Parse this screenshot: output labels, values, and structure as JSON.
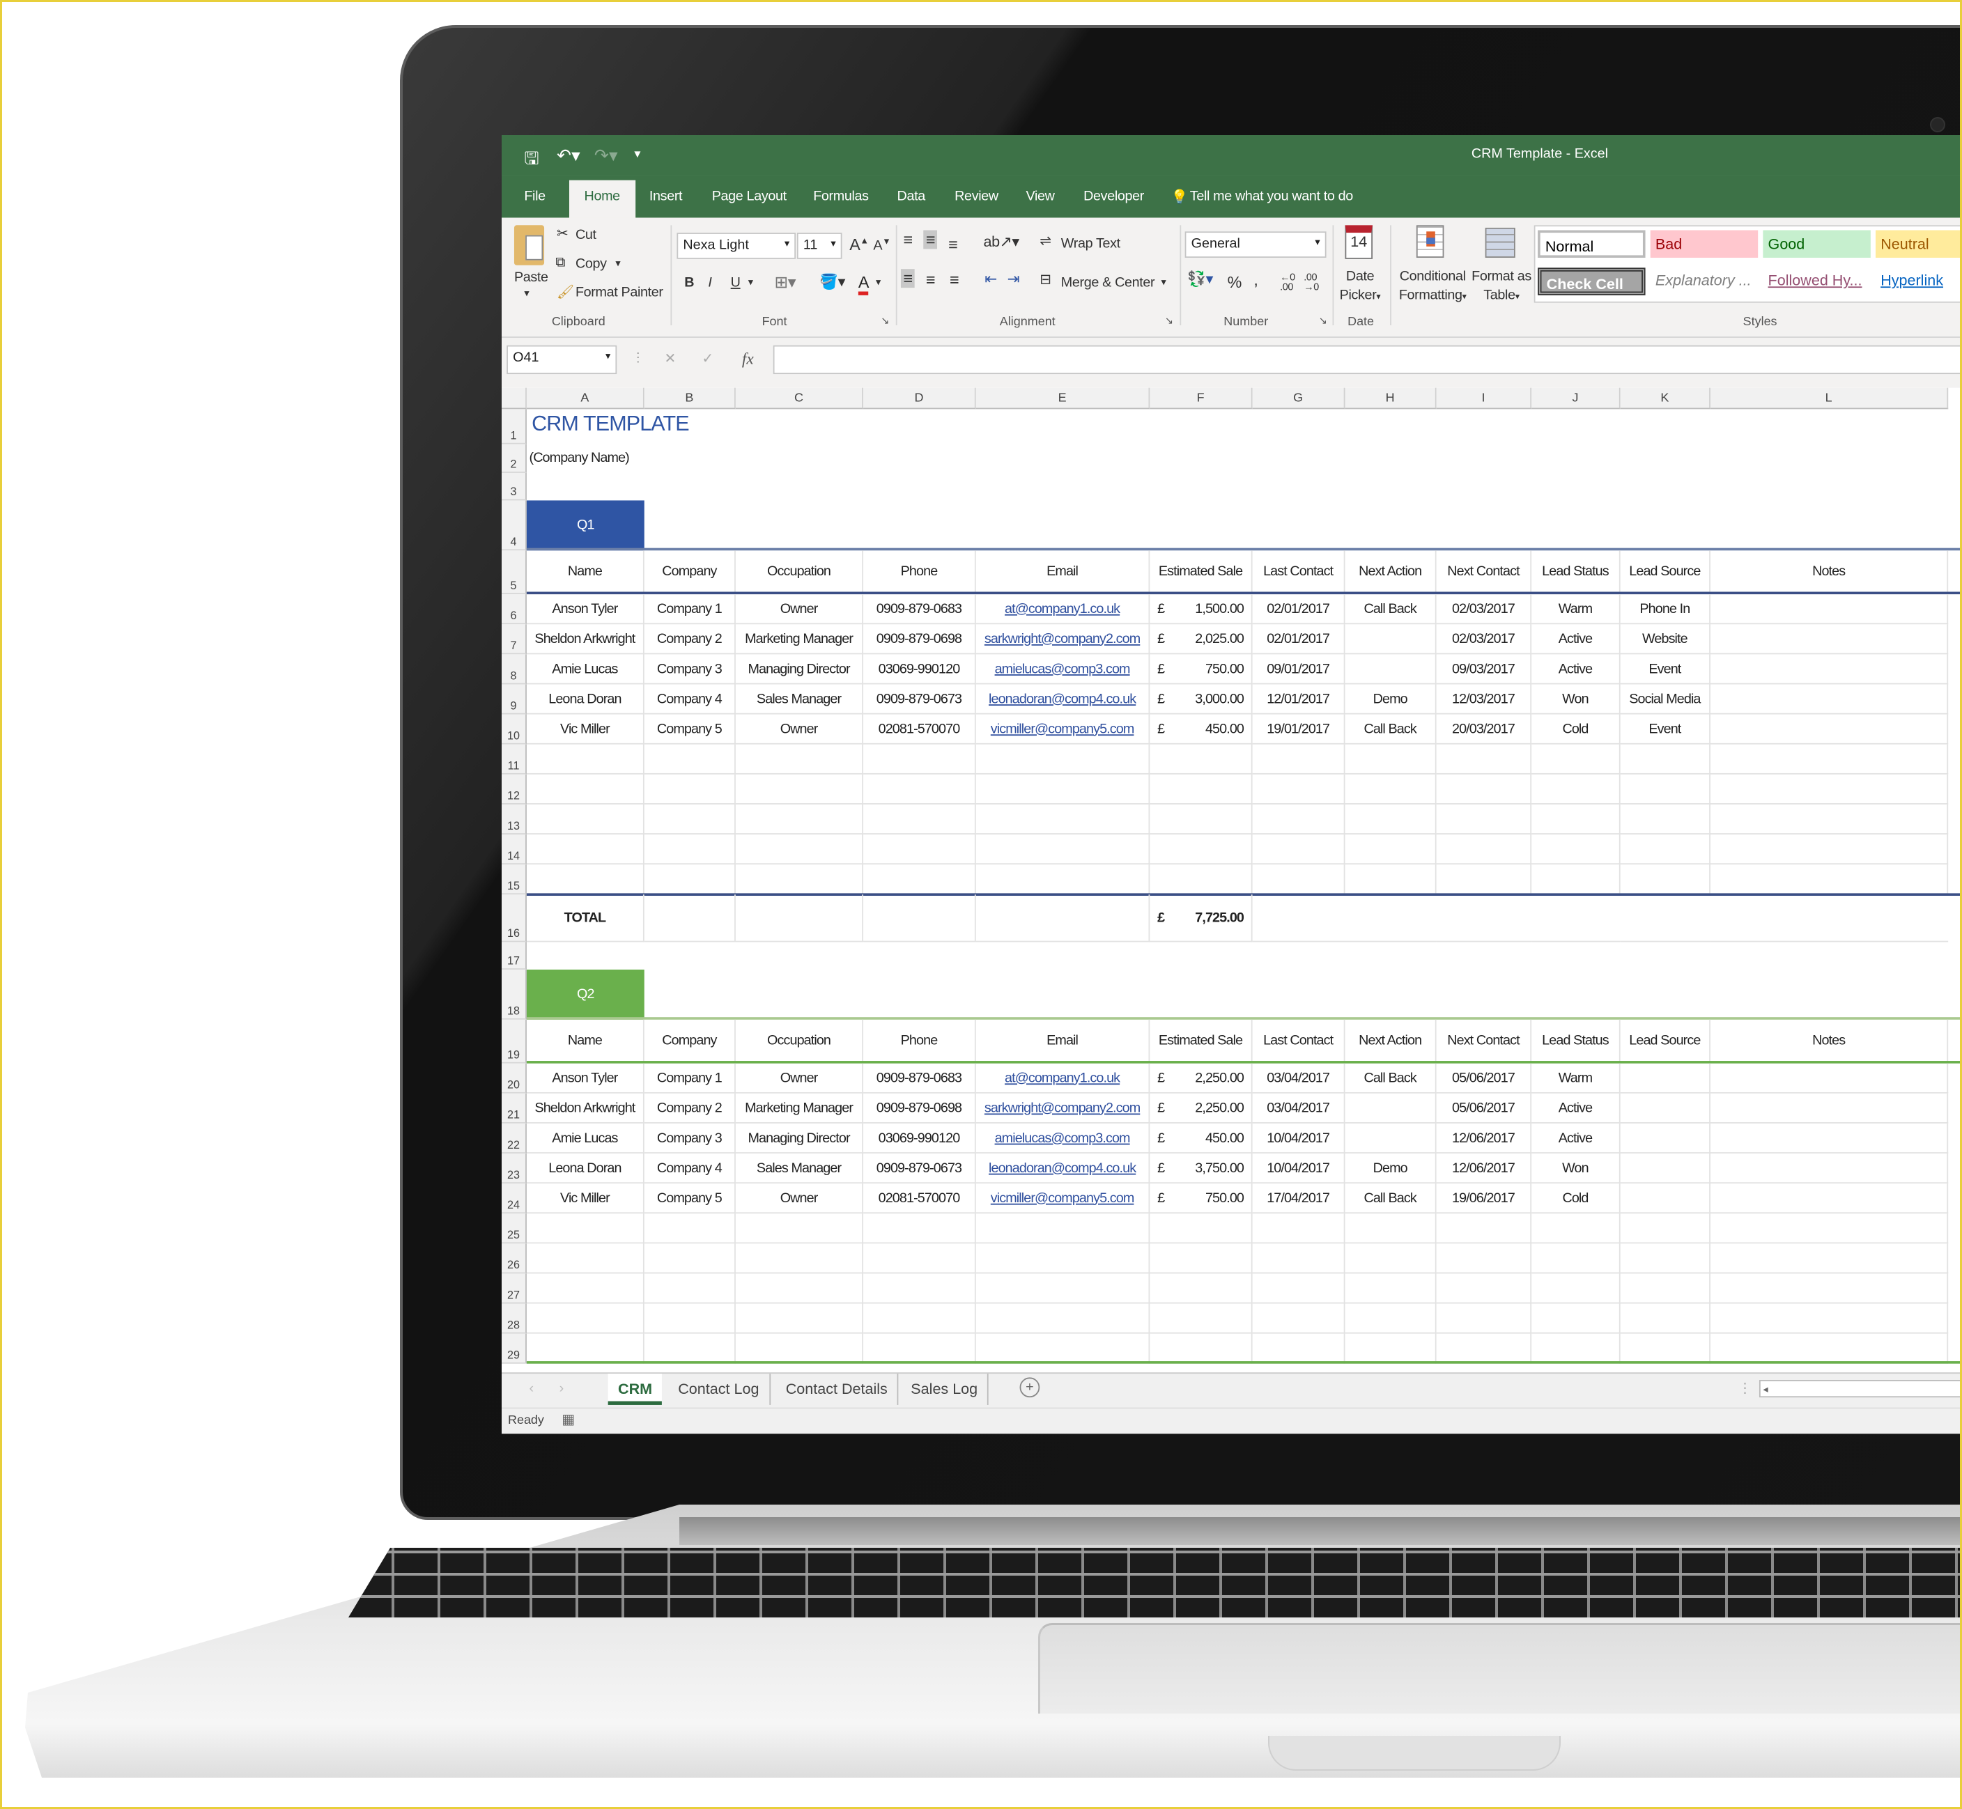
{
  "window": {
    "title": "CRM Template  -  Excel",
    "accent": "#3d7247"
  },
  "quick_access": {
    "save_icon": "save-icon",
    "undo_icon": "undo-icon",
    "redo_icon": "redo-icon",
    "customize_icon": "customize-icon"
  },
  "ribbon_tabs": [
    "File",
    "Home",
    "Insert",
    "Page Layout",
    "Formulas",
    "Data",
    "Review",
    "View",
    "Developer"
  ],
  "active_tab": "Home",
  "tell_me": "Tell me what you want to do",
  "clipboard": {
    "paste": "Paste",
    "cut": "Cut",
    "copy": "Copy",
    "format_painter": "Format Painter",
    "label": "Clipboard"
  },
  "font": {
    "name": "Nexa Light",
    "size": "11",
    "bold": "B",
    "italic": "I",
    "underline": "U",
    "label": "Font"
  },
  "alignment": {
    "wrap_text": "Wrap Text",
    "merge_center": "Merge & Center",
    "label": "Alignment"
  },
  "number": {
    "format": "General",
    "percent": "%",
    "comma": ",",
    "label": "Number"
  },
  "date": {
    "day": "14",
    "button_line1": "Date",
    "button_line2": "Picker",
    "label": "Date"
  },
  "conditional": {
    "line1": "Conditional",
    "line2": "Formatting"
  },
  "format_table": {
    "line1": "Format as",
    "line2": "Table"
  },
  "styles": {
    "label": "Styles",
    "items": [
      {
        "label": "Normal",
        "bg": "#ffffff",
        "fg": "#000000"
      },
      {
        "label": "Bad",
        "bg": "#ffc7ce",
        "fg": "#9c0006"
      },
      {
        "label": "Good",
        "bg": "#c6efce",
        "fg": "#006100"
      },
      {
        "label": "Neutral",
        "bg": "#ffeb9c",
        "fg": "#9c5700"
      },
      {
        "label": "Check Cell",
        "bg": "#a5a5a5",
        "fg": "#ffffff"
      },
      {
        "label": "Explanatory ...",
        "bg": "#ffffff",
        "fg": "#7f7f7f"
      },
      {
        "label": "Followed Hy...",
        "bg": "#ffffff",
        "fg": "#954f72"
      },
      {
        "label": "Hyperlink",
        "bg": "#ffffff",
        "fg": "#0563c1"
      }
    ]
  },
  "formula_bar": {
    "name_box": "O41",
    "cancel": "✕",
    "enter": "✓",
    "fx": "fx",
    "value": ""
  },
  "columns": [
    "A",
    "B",
    "C",
    "D",
    "E",
    "F",
    "G",
    "H",
    "I",
    "J",
    "K",
    "L"
  ],
  "sheet": {
    "title": "CRM TEMPLATE",
    "subtitle": "(Company Name)",
    "headers": [
      "Name",
      "Company",
      "Occupation",
      "Phone",
      "Email",
      "Estimated Sale",
      "Last Contact",
      "Next Action",
      "Next Contact",
      "Lead Status",
      "Lead Source",
      "Notes"
    ],
    "currency": "£",
    "total_label": "TOTAL",
    "sections": [
      {
        "label": "Q1",
        "color": "#2f55a4",
        "rows": [
          [
            "Anson Tyler",
            "Company 1",
            "Owner",
            "0909-879-0683",
            "at@company1.co.uk",
            "1,500.00",
            "02/01/2017",
            "Call Back",
            "02/03/2017",
            "Warm",
            "Phone In",
            ""
          ],
          [
            "Sheldon Arkwright",
            "Company 2",
            "Marketing Manager",
            "0909-879-0698",
            "sarkwright@company2.com",
            "2,025.00",
            "02/01/2017",
            "",
            "02/03/2017",
            "Active",
            "Website",
            ""
          ],
          [
            "Amie Lucas",
            "Company 3",
            "Managing Director",
            "03069-990120",
            "amielucas@comp3.com",
            "750.00",
            "09/01/2017",
            "",
            "09/03/2017",
            "Active",
            "Event",
            ""
          ],
          [
            "Leona Doran",
            "Company 4",
            "Sales Manager",
            "0909-879-0673",
            "leonadoran@comp4.co.uk",
            "3,000.00",
            "12/01/2017",
            "Demo",
            "12/03/2017",
            "Won",
            "Social Media",
            ""
          ],
          [
            "Vic Miller",
            "Company 5",
            "Owner",
            "02081-570070",
            "vicmiller@company5.com",
            "450.00",
            "19/01/2017",
            "Call Back",
            "20/03/2017",
            "Cold",
            "Event",
            ""
          ]
        ],
        "total": "7,725.00"
      },
      {
        "label": "Q2",
        "color": "#6ab04c",
        "rows": [
          [
            "Anson Tyler",
            "Company 1",
            "Owner",
            "0909-879-0683",
            "at@company1.co.uk",
            "2,250.00",
            "03/04/2017",
            "Call Back",
            "05/06/2017",
            "Warm",
            "",
            ""
          ],
          [
            "Sheldon Arkwright",
            "Company 2",
            "Marketing Manager",
            "0909-879-0698",
            "sarkwright@company2.com",
            "2,250.00",
            "03/04/2017",
            "",
            "05/06/2017",
            "Active",
            "",
            ""
          ],
          [
            "Amie Lucas",
            "Company 3",
            "Managing Director",
            "03069-990120",
            "amielucas@comp3.com",
            "450.00",
            "10/04/2017",
            "",
            "12/06/2017",
            "Active",
            "",
            ""
          ],
          [
            "Leona Doran",
            "Company 4",
            "Sales Manager",
            "0909-879-0673",
            "leonadoran@comp4.co.uk",
            "3,750.00",
            "10/04/2017",
            "Demo",
            "12/06/2017",
            "Won",
            "",
            ""
          ],
          [
            "Vic Miller",
            "Company 5",
            "Owner",
            "02081-570070",
            "vicmiller@company5.com",
            "750.00",
            "17/04/2017",
            "Call Back",
            "19/06/2017",
            "Cold",
            "",
            ""
          ]
        ]
      }
    ]
  },
  "sheet_tabs": [
    "CRM",
    "Contact Log",
    "Contact Details",
    "Sales Log"
  ],
  "active_sheet": "CRM",
  "status": {
    "text": "Ready"
  }
}
